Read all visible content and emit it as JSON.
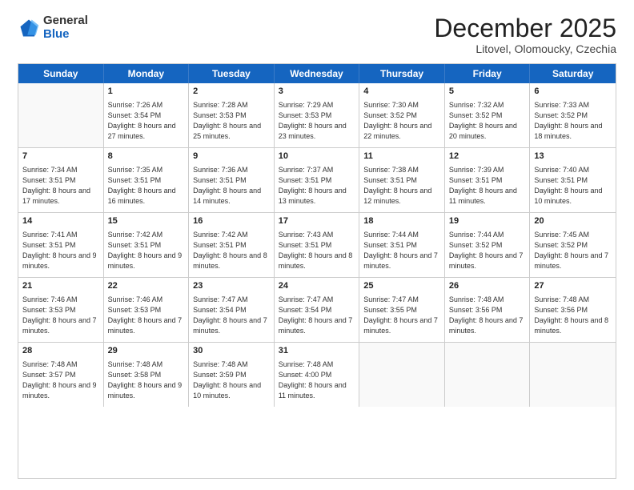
{
  "logo": {
    "general": "General",
    "blue": "Blue"
  },
  "header": {
    "month": "December 2025",
    "location": "Litovel, Olomoucky, Czechia"
  },
  "weekdays": [
    "Sunday",
    "Monday",
    "Tuesday",
    "Wednesday",
    "Thursday",
    "Friday",
    "Saturday"
  ],
  "weeks": [
    [
      {
        "day": "",
        "sunrise": "",
        "sunset": "",
        "daylight": ""
      },
      {
        "day": "1",
        "sunrise": "Sunrise: 7:26 AM",
        "sunset": "Sunset: 3:54 PM",
        "daylight": "Daylight: 8 hours and 27 minutes."
      },
      {
        "day": "2",
        "sunrise": "Sunrise: 7:28 AM",
        "sunset": "Sunset: 3:53 PM",
        "daylight": "Daylight: 8 hours and 25 minutes."
      },
      {
        "day": "3",
        "sunrise": "Sunrise: 7:29 AM",
        "sunset": "Sunset: 3:53 PM",
        "daylight": "Daylight: 8 hours and 23 minutes."
      },
      {
        "day": "4",
        "sunrise": "Sunrise: 7:30 AM",
        "sunset": "Sunset: 3:52 PM",
        "daylight": "Daylight: 8 hours and 22 minutes."
      },
      {
        "day": "5",
        "sunrise": "Sunrise: 7:32 AM",
        "sunset": "Sunset: 3:52 PM",
        "daylight": "Daylight: 8 hours and 20 minutes."
      },
      {
        "day": "6",
        "sunrise": "Sunrise: 7:33 AM",
        "sunset": "Sunset: 3:52 PM",
        "daylight": "Daylight: 8 hours and 18 minutes."
      }
    ],
    [
      {
        "day": "7",
        "sunrise": "Sunrise: 7:34 AM",
        "sunset": "Sunset: 3:51 PM",
        "daylight": "Daylight: 8 hours and 17 minutes."
      },
      {
        "day": "8",
        "sunrise": "Sunrise: 7:35 AM",
        "sunset": "Sunset: 3:51 PM",
        "daylight": "Daylight: 8 hours and 16 minutes."
      },
      {
        "day": "9",
        "sunrise": "Sunrise: 7:36 AM",
        "sunset": "Sunset: 3:51 PM",
        "daylight": "Daylight: 8 hours and 14 minutes."
      },
      {
        "day": "10",
        "sunrise": "Sunrise: 7:37 AM",
        "sunset": "Sunset: 3:51 PM",
        "daylight": "Daylight: 8 hours and 13 minutes."
      },
      {
        "day": "11",
        "sunrise": "Sunrise: 7:38 AM",
        "sunset": "Sunset: 3:51 PM",
        "daylight": "Daylight: 8 hours and 12 minutes."
      },
      {
        "day": "12",
        "sunrise": "Sunrise: 7:39 AM",
        "sunset": "Sunset: 3:51 PM",
        "daylight": "Daylight: 8 hours and 11 minutes."
      },
      {
        "day": "13",
        "sunrise": "Sunrise: 7:40 AM",
        "sunset": "Sunset: 3:51 PM",
        "daylight": "Daylight: 8 hours and 10 minutes."
      }
    ],
    [
      {
        "day": "14",
        "sunrise": "Sunrise: 7:41 AM",
        "sunset": "Sunset: 3:51 PM",
        "daylight": "Daylight: 8 hours and 9 minutes."
      },
      {
        "day": "15",
        "sunrise": "Sunrise: 7:42 AM",
        "sunset": "Sunset: 3:51 PM",
        "daylight": "Daylight: 8 hours and 9 minutes."
      },
      {
        "day": "16",
        "sunrise": "Sunrise: 7:42 AM",
        "sunset": "Sunset: 3:51 PM",
        "daylight": "Daylight: 8 hours and 8 minutes."
      },
      {
        "day": "17",
        "sunrise": "Sunrise: 7:43 AM",
        "sunset": "Sunset: 3:51 PM",
        "daylight": "Daylight: 8 hours and 8 minutes."
      },
      {
        "day": "18",
        "sunrise": "Sunrise: 7:44 AM",
        "sunset": "Sunset: 3:51 PM",
        "daylight": "Daylight: 8 hours and 7 minutes."
      },
      {
        "day": "19",
        "sunrise": "Sunrise: 7:44 AM",
        "sunset": "Sunset: 3:52 PM",
        "daylight": "Daylight: 8 hours and 7 minutes."
      },
      {
        "day": "20",
        "sunrise": "Sunrise: 7:45 AM",
        "sunset": "Sunset: 3:52 PM",
        "daylight": "Daylight: 8 hours and 7 minutes."
      }
    ],
    [
      {
        "day": "21",
        "sunrise": "Sunrise: 7:46 AM",
        "sunset": "Sunset: 3:53 PM",
        "daylight": "Daylight: 8 hours and 7 minutes."
      },
      {
        "day": "22",
        "sunrise": "Sunrise: 7:46 AM",
        "sunset": "Sunset: 3:53 PM",
        "daylight": "Daylight: 8 hours and 7 minutes."
      },
      {
        "day": "23",
        "sunrise": "Sunrise: 7:47 AM",
        "sunset": "Sunset: 3:54 PM",
        "daylight": "Daylight: 8 hours and 7 minutes."
      },
      {
        "day": "24",
        "sunrise": "Sunrise: 7:47 AM",
        "sunset": "Sunset: 3:54 PM",
        "daylight": "Daylight: 8 hours and 7 minutes."
      },
      {
        "day": "25",
        "sunrise": "Sunrise: 7:47 AM",
        "sunset": "Sunset: 3:55 PM",
        "daylight": "Daylight: 8 hours and 7 minutes."
      },
      {
        "day": "26",
        "sunrise": "Sunrise: 7:48 AM",
        "sunset": "Sunset: 3:56 PM",
        "daylight": "Daylight: 8 hours and 7 minutes."
      },
      {
        "day": "27",
        "sunrise": "Sunrise: 7:48 AM",
        "sunset": "Sunset: 3:56 PM",
        "daylight": "Daylight: 8 hours and 8 minutes."
      }
    ],
    [
      {
        "day": "28",
        "sunrise": "Sunrise: 7:48 AM",
        "sunset": "Sunset: 3:57 PM",
        "daylight": "Daylight: 8 hours and 9 minutes."
      },
      {
        "day": "29",
        "sunrise": "Sunrise: 7:48 AM",
        "sunset": "Sunset: 3:58 PM",
        "daylight": "Daylight: 8 hours and 9 minutes."
      },
      {
        "day": "30",
        "sunrise": "Sunrise: 7:48 AM",
        "sunset": "Sunset: 3:59 PM",
        "daylight": "Daylight: 8 hours and 10 minutes."
      },
      {
        "day": "31",
        "sunrise": "Sunrise: 7:48 AM",
        "sunset": "Sunset: 4:00 PM",
        "daylight": "Daylight: 8 hours and 11 minutes."
      },
      {
        "day": "",
        "sunrise": "",
        "sunset": "",
        "daylight": ""
      },
      {
        "day": "",
        "sunrise": "",
        "sunset": "",
        "daylight": ""
      },
      {
        "day": "",
        "sunrise": "",
        "sunset": "",
        "daylight": ""
      }
    ]
  ]
}
